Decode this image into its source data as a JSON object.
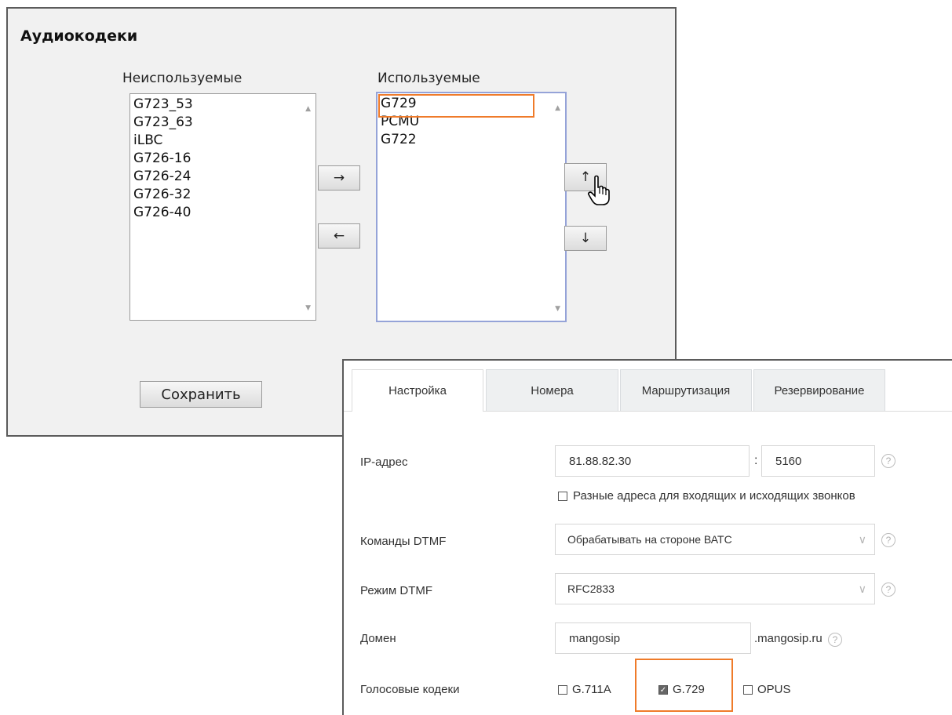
{
  "codec_dialog": {
    "title": "Аудиокодеки",
    "unused_label": "Неиспользуемые",
    "used_label": "Используемые",
    "unused_codecs": [
      "G723_53",
      "G723_63",
      "iLBC",
      "G726-16",
      "G726-24",
      "G726-32",
      "G726-40"
    ],
    "used_codecs": [
      "G729",
      "PCMU",
      "G722"
    ],
    "move_right_glyph": "→",
    "move_left_glyph": "←",
    "move_up_glyph": "↑",
    "move_down_glyph": "↓",
    "save_label": "Сохранить",
    "highlight_color": "#ef7b2a"
  },
  "settings": {
    "tabs": [
      {
        "label": "Настройка",
        "active": true
      },
      {
        "label": "Номера",
        "active": false
      },
      {
        "label": "Маршрутизация",
        "active": false
      },
      {
        "label": "Резервирование",
        "active": false
      }
    ],
    "ip": {
      "label": "IP-адрес",
      "address": "81.88.82.30",
      "separator": ":",
      "port": "5160"
    },
    "different_addresses": {
      "label": "Разные адреса для входящих и исходящих звонков",
      "checked": false
    },
    "dtmf_commands": {
      "label": "Команды DTMF",
      "value": "Обрабатывать на стороне ВАТС"
    },
    "dtmf_mode": {
      "label": "Режим DTMF",
      "value": "RFC2833"
    },
    "domain": {
      "label": "Домен",
      "value": "mangosip",
      "suffix": ".mangosip.ru"
    },
    "voice_codecs": {
      "label": "Голосовые кодеки",
      "options": [
        {
          "label": "G.711A",
          "checked": false
        },
        {
          "label": "G.729",
          "checked": true
        },
        {
          "label": "OPUS",
          "checked": false
        }
      ]
    },
    "help_glyph": "?",
    "chevron_glyph": "∨",
    "check_glyph": "✓"
  }
}
